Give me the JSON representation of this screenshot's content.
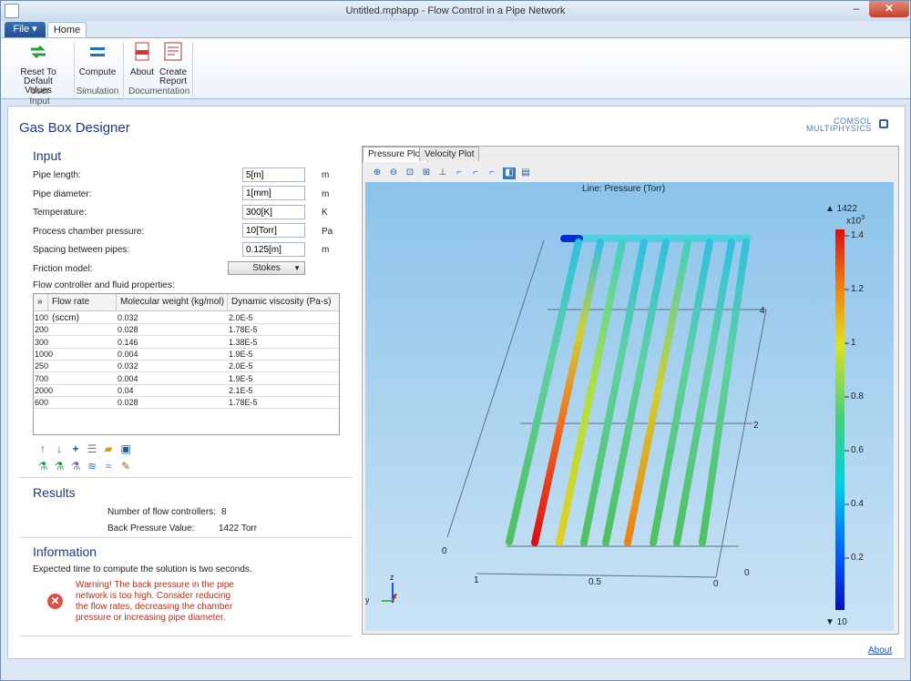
{
  "window": {
    "title": "Untitled.mphapp - Flow Control in a Pipe Network"
  },
  "menu": {
    "file": "File ▾",
    "home": "Home"
  },
  "ribbon": {
    "reset_line1": "Reset To",
    "reset_line2": "Default Values",
    "group_user_input": "User Input",
    "compute": "Compute",
    "group_simulation": "Simulation",
    "about": "About",
    "create_line1": "Create",
    "create_line2": "Report",
    "group_documentation": "Documentation"
  },
  "app": {
    "title": "Gas Box Designer",
    "logo_line1": "COMSOL",
    "logo_line2": "MULTIPHYSICS"
  },
  "input": {
    "heading": "Input",
    "pipe_length": {
      "label": "Pipe length:",
      "value": "5[m]",
      "unit": "m"
    },
    "pipe_diameter": {
      "label": "Pipe diameter:",
      "value": "1[mm]",
      "unit": "m"
    },
    "temperature": {
      "label": "Temperature:",
      "value": "300[K]",
      "unit": "K"
    },
    "chamber_pressure": {
      "label": "Process chamber pressure:",
      "value": "10[Torr]",
      "unit": "Pa"
    },
    "spacing": {
      "label": "Spacing between pipes:",
      "value": "0.125[m]",
      "unit": "m"
    },
    "friction": {
      "label": "Friction model:",
      "value": "Stokes"
    },
    "table_caption": "Flow controller and fluid properties:",
    "table": {
      "corner": "»",
      "headers": [
        "Flow rate (sccm)",
        "Molecular weight (kg/mol)",
        "Dynamic viscosity (Pa-s)"
      ],
      "rows": [
        [
          "100",
          "0.032",
          "2.0E-5"
        ],
        [
          "200",
          "0.028",
          "1.78E-5"
        ],
        [
          "300",
          "0.146",
          "1.38E-5"
        ],
        [
          "1000",
          "0.004",
          "1.9E-5"
        ],
        [
          "250",
          "0.032",
          "2.0E-5"
        ],
        [
          "700",
          "0.004",
          "1.9E-5"
        ],
        [
          "2000",
          "0.04",
          "2.1E-5"
        ],
        [
          "600",
          "0.028",
          "1.78E-5"
        ]
      ]
    }
  },
  "results": {
    "heading": "Results",
    "count_label": "Number of flow controllers:",
    "count_value": "8",
    "bp_label": "Back Pressure Value:",
    "bp_value": "1422 Torr"
  },
  "information": {
    "heading": "Information",
    "time_text": "Expected time to compute the solution is two seconds.",
    "warn_1": "Warning! The back pressure in the pipe",
    "warn_2": "network is too high. Consider reducing",
    "warn_3": "the flow rates, decreasing the chamber",
    "warn_4": "pressure or increasing pipe diameter."
  },
  "plot": {
    "tab_pressure": "Pressure Plot",
    "tab_velocity": "Velocity Plot",
    "title": "Line: Pressure (Torr)",
    "colorbar_max": "▲ 1422",
    "colorbar_exp": "x10",
    "colorbar_exp_sup": "3",
    "colorbar_min": "▼ 10",
    "colorbar_ticks": [
      "1.4",
      "1.2",
      "1",
      "0.8",
      "0.6",
      "0.4",
      "0.2"
    ],
    "axis_labels": {
      "y4": "4",
      "y2": "2",
      "z0": "0",
      "x1": "1",
      "x05": "0.5",
      "x0": "0",
      "y0": "0"
    },
    "triad": {
      "z": "z",
      "y": "y",
      "x": "x"
    }
  },
  "footer": {
    "about": "About"
  }
}
